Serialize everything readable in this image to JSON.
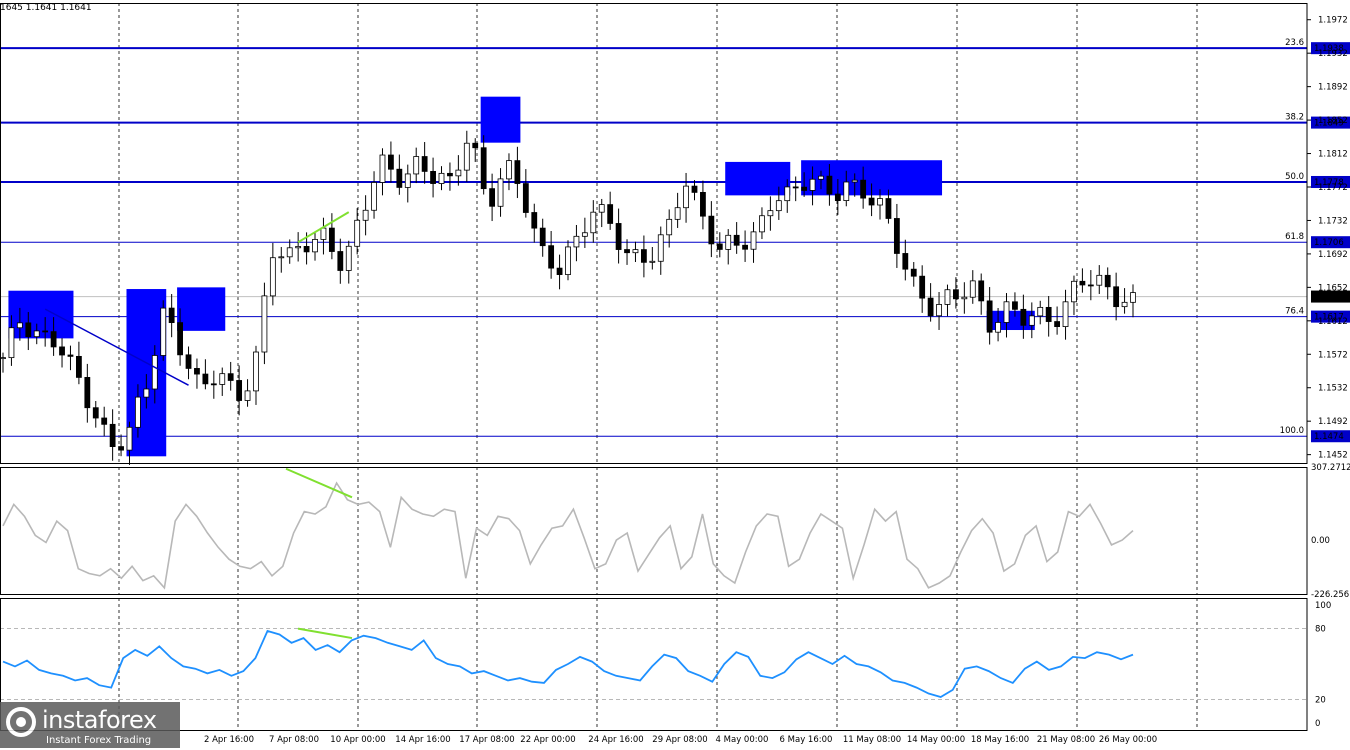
{
  "header": {
    "ohlc": "1645 1.1641 1.1641"
  },
  "brand": {
    "name": "instaforex",
    "tagline": "Instant Forex Trading"
  },
  "colors": {
    "fib": "#0000c8",
    "box": "#0000ff",
    "divergence": "#80e030",
    "cci": "#b8b8b8",
    "rsi": "#1e90ff",
    "trend": "#0000c8"
  },
  "chart_data": [
    {
      "type": "candlestick",
      "price_axis": {
        "range": [
          1.1442,
          1.1992
        ],
        "ticks": [
          "1.1972",
          "1.1932",
          "1.1892",
          "1.1852",
          "1.1812",
          "1.1772",
          "1.1732",
          "1.1692",
          "1.1652",
          "1.1612",
          "1.1572",
          "1.1532",
          "1.1492",
          "1.1452"
        ]
      },
      "current_price": "1.1641",
      "fib_levels": [
        {
          "pct": "23.6",
          "price": "1.1938"
        },
        {
          "pct": "38.2",
          "price": "1.1849"
        },
        {
          "pct": "50.0",
          "price": "1.1778"
        },
        {
          "pct": "61.8",
          "price": "1.1706"
        },
        {
          "pct": "76.4",
          "price": "1.1617"
        },
        {
          "pct": "100.0",
          "price": "1.1474"
        }
      ],
      "time_labels": [
        "2 Apr 16:00",
        "7 Apr 08:00",
        "10 Apr 00:00",
        "14 Apr 16:00",
        "17 Apr 08:00",
        "22 Apr 00:00",
        "24 Apr 16:00",
        "29 Apr 08:00",
        "4 May 00:00",
        "6 May 16:00",
        "11 May 08:00",
        "14 May 00:00",
        "18 May 16:00",
        "21 May 08:00",
        "26 May 00:00"
      ],
      "closes": [
        1.156,
        1.1615,
        1.16,
        1.159,
        1.154,
        1.1505,
        1.147,
        1.1478,
        1.153,
        1.1622,
        1.1585,
        1.153,
        1.1545,
        1.1515,
        1.156,
        1.17,
        1.168,
        1.1705,
        1.172,
        1.168,
        1.173,
        1.18,
        1.179,
        1.18,
        1.178,
        1.177,
        1.185,
        1.175,
        1.179,
        1.176,
        1.17,
        1.168,
        1.17,
        1.1745,
        1.173,
        1.169,
        1.168,
        1.171,
        1.179,
        1.174,
        1.169,
        1.17,
        1.172,
        1.177,
        1.1755,
        1.178,
        1.177,
        1.178,
        1.176,
        1.174,
        1.17,
        1.165,
        1.162,
        1.1635,
        1.166,
        1.1615,
        1.162,
        1.161,
        1.162,
        1.1625,
        1.166,
        1.165,
        1.1645,
        1.1641
      ],
      "signal_boxes": [
        {
          "from": 1,
          "to": 8,
          "high": 1.1648,
          "low": 1.1591
        },
        {
          "from": 15,
          "to": 19,
          "high": 1.165,
          "low": 1.145
        },
        {
          "from": 21,
          "to": 26,
          "high": 1.1652,
          "low": 1.16
        },
        {
          "from": 57,
          "to": 61,
          "high": 1.188,
          "low": 1.1825
        },
        {
          "from": 86,
          "to": 93,
          "high": 1.1802,
          "low": 1.1762
        },
        {
          "from": 95,
          "to": 111,
          "high": 1.1804,
          "low": 1.1762
        },
        {
          "from": 117,
          "to": 122,
          "high": 1.1624,
          "low": 1.1601
        }
      ]
    },
    {
      "type": "line",
      "name": "CCI",
      "axis_ticks": [
        "307.2712",
        "0.00",
        "-226.2561"
      ],
      "range": [
        -226.2561,
        307.2712
      ],
      "values": [
        60,
        150,
        100,
        20,
        -10,
        80,
        40,
        -120,
        -140,
        -150,
        -120,
        -160,
        -110,
        -170,
        -150,
        -200,
        80,
        150,
        100,
        30,
        -30,
        -80,
        -110,
        -120,
        -90,
        -150,
        -110,
        30,
        120,
        110,
        140,
        240,
        170,
        150,
        160,
        120,
        -30,
        180,
        130,
        110,
        100,
        130,
        120,
        -160,
        50,
        20,
        100,
        90,
        40,
        -100,
        -20,
        50,
        60,
        130,
        10,
        -120,
        -100,
        0,
        30,
        -130,
        -60,
        10,
        60,
        -120,
        -70,
        110,
        -100,
        -150,
        -180,
        -50,
        60,
        110,
        100,
        -110,
        -80,
        30,
        110,
        80,
        50,
        -160,
        -20,
        130,
        80,
        120,
        -80,
        -120,
        -200,
        -180,
        -150,
        -50,
        40,
        90,
        30,
        -130,
        -100,
        20,
        60,
        -90,
        -50,
        120,
        100,
        150,
        70,
        -20,
        0,
        40
      ]
    },
    {
      "type": "line",
      "name": "RSI",
      "axis_ticks": [
        "100",
        "80",
        "20",
        "0"
      ],
      "range": [
        0,
        100
      ],
      "levels": [
        80,
        20
      ],
      "values": [
        52,
        48,
        53,
        45,
        42,
        40,
        36,
        38,
        32,
        30,
        55,
        62,
        57,
        65,
        55,
        48,
        46,
        42,
        45,
        40,
        44,
        55,
        78,
        75,
        68,
        72,
        62,
        66,
        60,
        70,
        74,
        72,
        68,
        65,
        62,
        70,
        55,
        50,
        48,
        42,
        44,
        40,
        36,
        38,
        35,
        34,
        45,
        50,
        56,
        52,
        44,
        40,
        38,
        36,
        48,
        58,
        55,
        44,
        40,
        35,
        50,
        60,
        56,
        40,
        38,
        43,
        54,
        60,
        55,
        50,
        57,
        50,
        48,
        43,
        36,
        34,
        30,
        25,
        22,
        28,
        46,
        48,
        44,
        38,
        34,
        46,
        52,
        45,
        48,
        56,
        55,
        60,
        58,
        54,
        58
      ]
    }
  ]
}
